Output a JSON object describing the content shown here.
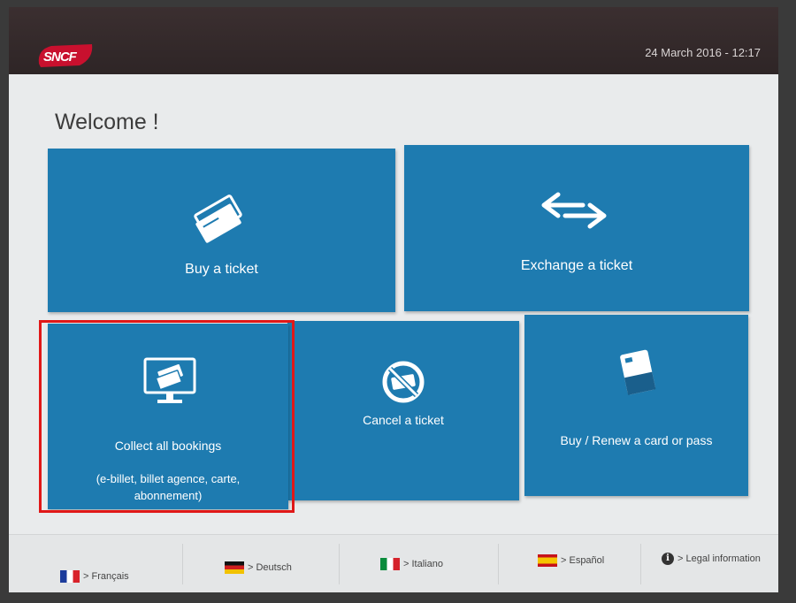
{
  "header": {
    "brand": "SNCF",
    "datetime": "24 March 2016 - 12:17"
  },
  "main": {
    "title": "Welcome !",
    "tiles": [
      {
        "label": "Buy a ticket",
        "icon": "tickets-icon"
      },
      {
        "label": "Exchange a ticket",
        "icon": "exchange-arrows-icon"
      },
      {
        "label": "Collect all bookings",
        "sublabel": "(e-billet, billet agence, carte, abonnement)",
        "icon": "monitor-tickets-icon"
      },
      {
        "label": "Cancel a ticket",
        "icon": "no-ticket-icon"
      },
      {
        "label": "Buy / Renew a card or pass",
        "icon": "card-pass-icon"
      }
    ]
  },
  "footer": {
    "languages": [
      {
        "label": "> Français",
        "flag": "france-flag"
      },
      {
        "label": "> Deutsch",
        "flag": "germany-flag"
      },
      {
        "label": "> Italiano",
        "flag": "italy-flag"
      },
      {
        "label": "> Español",
        "flag": "spain-flag"
      }
    ],
    "legal": "> Legal information"
  },
  "colors": {
    "tile": "#1e7bb0",
    "header": "#2e2526",
    "brand_red": "#c8102e",
    "highlight": "#e01818"
  }
}
